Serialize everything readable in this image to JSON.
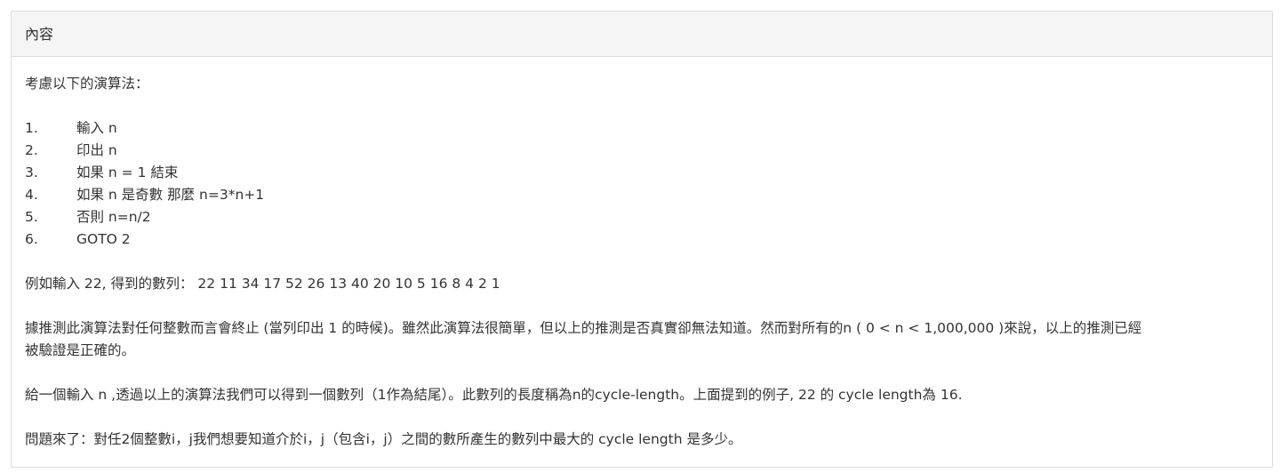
{
  "heading": "內容",
  "intro": "考慮以下的演算法：",
  "steps": [
    {
      "num": "1.",
      "text": "輸入 n"
    },
    {
      "num": "2.",
      "text": "印出 n"
    },
    {
      "num": "3.",
      "text": "如果 n = 1 結束"
    },
    {
      "num": "4.",
      "text": "如果 n 是奇數 那麼 n=3*n+1"
    },
    {
      "num": "5.",
      "text": "否則 n=n/2"
    },
    {
      "num": "6.",
      "text": "GOTO 2"
    }
  ],
  "example": "例如輸入 22, 得到的數列： 22 11 34 17 52 26 13 40 20 10 5 16 8 4 2 1",
  "conjecture_line1": "據推測此演算法對任何整數而言會終止 (當列印出 1 的時候)。雖然此演算法很簡單，但以上的推測是否真實卻無法知道。然而對所有的n ( 0 < n < 1,000,000 )來說，以上的推測已經",
  "conjecture_line2": "被驗證是正確的。",
  "cycle_length": "給一個輸入 n ,透過以上的演算法我們可以得到一個數列（1作為結尾）。此數列的長度稱為n的cycle-length。上面提到的例子, 22 的 cycle length為 16.",
  "question": "問題來了：對任2個整數i，j我們想要知道介於i，j（包含i，j）之間的數所產生的數列中最大的 cycle length 是多少。"
}
